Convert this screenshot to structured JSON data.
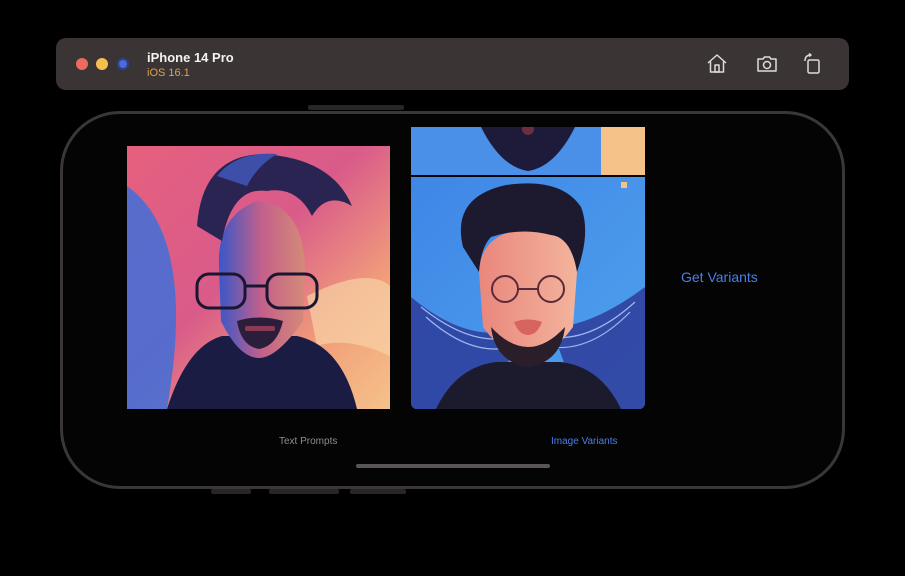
{
  "titlebar": {
    "device_name": "iPhone 14 Pro",
    "os_version": "iOS 16.1",
    "buttons": [
      "home-icon",
      "screenshot-icon",
      "rotate-icon"
    ]
  },
  "app": {
    "action_button": "Get Variants",
    "tabs": [
      {
        "label": "Text Prompts",
        "selected": false
      },
      {
        "label": "Image Variants",
        "selected": true
      }
    ]
  },
  "colors": {
    "accent": "#4a7fe8",
    "inactive_tab": "#8d8d8d",
    "titlebar_bg": "#3a3435",
    "os_version": "#e0a24e"
  }
}
